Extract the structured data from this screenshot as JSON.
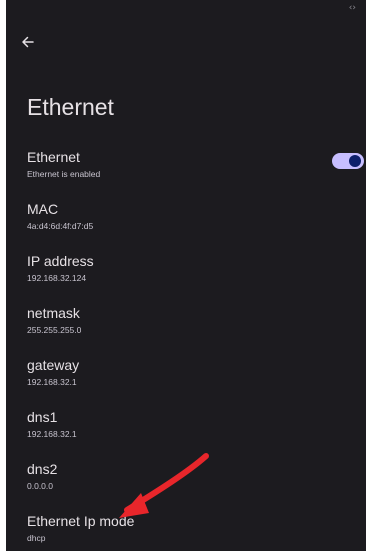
{
  "status_bar": {
    "indicator_text": "‹›"
  },
  "toolbar": {
    "back_icon": "arrow-left"
  },
  "page": {
    "title": "Ethernet"
  },
  "settings": [
    {
      "title": "Ethernet",
      "summary": "Ethernet is enabled",
      "toggle_on": true
    },
    {
      "title": "MAC",
      "summary": "4a:d4:6d:4f:d7:d5"
    },
    {
      "title": "IP address",
      "summary": "192.168.32.124"
    },
    {
      "title": "netmask",
      "summary": "255.255.255.0"
    },
    {
      "title": "gateway",
      "summary": "192.168.32.1"
    },
    {
      "title": "dns1",
      "summary": "192.168.32.1"
    },
    {
      "title": "dns2",
      "summary": "0.0.0.0"
    },
    {
      "title": "Ethernet Ip mode",
      "summary": "dhcp"
    }
  ],
  "colors": {
    "background": "#1c1b1f",
    "text_primary": "#e6e1e5",
    "text_secondary": "#c8c4cf",
    "toggle_track": "#c7beff",
    "toggle_thumb": "#0d1f6b",
    "annotation_arrow": "#e8262b"
  }
}
